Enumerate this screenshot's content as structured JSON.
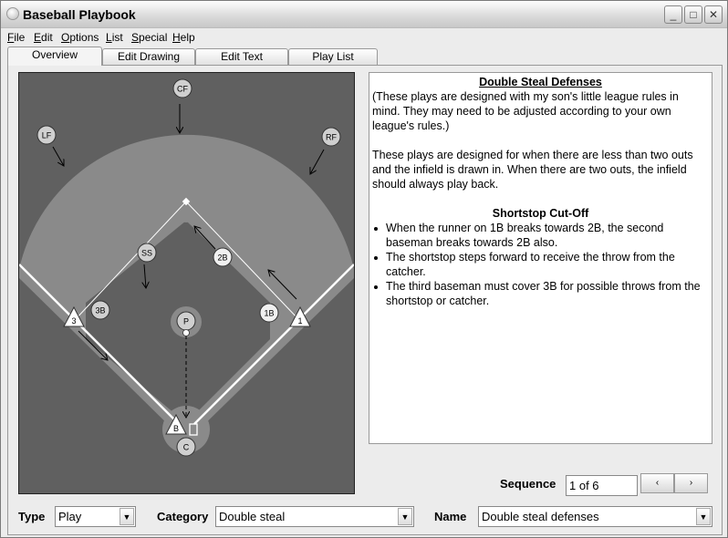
{
  "window": {
    "title": "Baseball Playbook"
  },
  "menu": [
    "File",
    "Edit",
    "Options",
    "List",
    "Special",
    "Help"
  ],
  "tabs": [
    "Overview",
    "Edit Drawing",
    "Edit Text",
    "Play List"
  ],
  "field": {
    "players": [
      "CF",
      "LF",
      "RF",
      "SS",
      "2B",
      "3B",
      "1B",
      "P",
      "C"
    ],
    "runners": [
      "3",
      "1",
      "B"
    ]
  },
  "description": {
    "title": "Double Steal Defenses",
    "para1": "(These plays are designed with my son's little league rules in mind.  They may need to be adjusted according to your own league's rules.)",
    "para2": "These plays are designed for when there are less than two outs and the infield is drawn in.  When there are two outs, the infield should always play back.",
    "subtitle": "Shortstop Cut-Off",
    "bullets": [
      "When the runner on 1B breaks towards 2B, the second baseman breaks towards 2B also.",
      "The shortstop steps forward to receive the throw from the catcher.",
      "The third baseman must cover 3B for possible throws from the shortstop or catcher."
    ]
  },
  "sequence": {
    "label": "Sequence",
    "value": "1 of 6",
    "prev": "‹",
    "next": "›"
  },
  "filters": {
    "type_label": "Type",
    "type_value": "Play",
    "category_label": "Category",
    "category_value": "Double steal",
    "name_label": "Name",
    "name_value": "Double steal defenses"
  }
}
